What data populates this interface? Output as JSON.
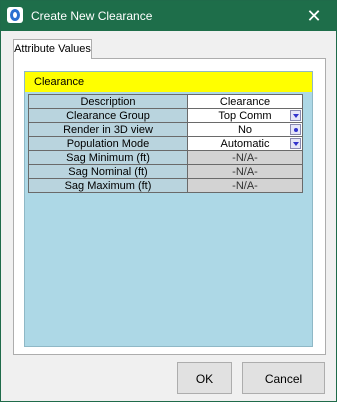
{
  "window": {
    "title": "Create New Clearance",
    "close_glyph": "✕"
  },
  "tabs": [
    {
      "label": "Attribute Values",
      "selected": true
    }
  ],
  "section": {
    "header": "Clearance"
  },
  "table": {
    "rows": [
      {
        "label": "Description",
        "value": "Clearance",
        "control": "text",
        "disabled": false
      },
      {
        "label": "Clearance Group",
        "value": "Top Comm",
        "control": "dropdown",
        "disabled": false
      },
      {
        "label": "Render in 3D view",
        "value": "No",
        "control": "toggle",
        "disabled": false
      },
      {
        "label": "Population Mode",
        "value": "Automatic",
        "control": "dropdown",
        "disabled": false
      },
      {
        "label": "Sag Minimum (ft)",
        "value": "-N/A-",
        "control": "text",
        "disabled": true
      },
      {
        "label": "Sag Nominal (ft)",
        "value": "-N/A-",
        "control": "text",
        "disabled": true
      },
      {
        "label": "Sag Maximum (ft)",
        "value": "-N/A-",
        "control": "text",
        "disabled": true
      }
    ]
  },
  "buttons": {
    "ok": "OK",
    "cancel": "Cancel"
  },
  "colors": {
    "titlebar": "#1e6e4a",
    "section_header": "#ffff00",
    "panel_background": "#add8e6",
    "label_cell": "#b9d4de",
    "disabled_cell": "#d3d3d3"
  },
  "icons": {
    "app": "app-logo-icon",
    "close": "close-icon",
    "dropdown": "dropdown-arrow-icon",
    "toggle": "toggle-dot-icon"
  }
}
